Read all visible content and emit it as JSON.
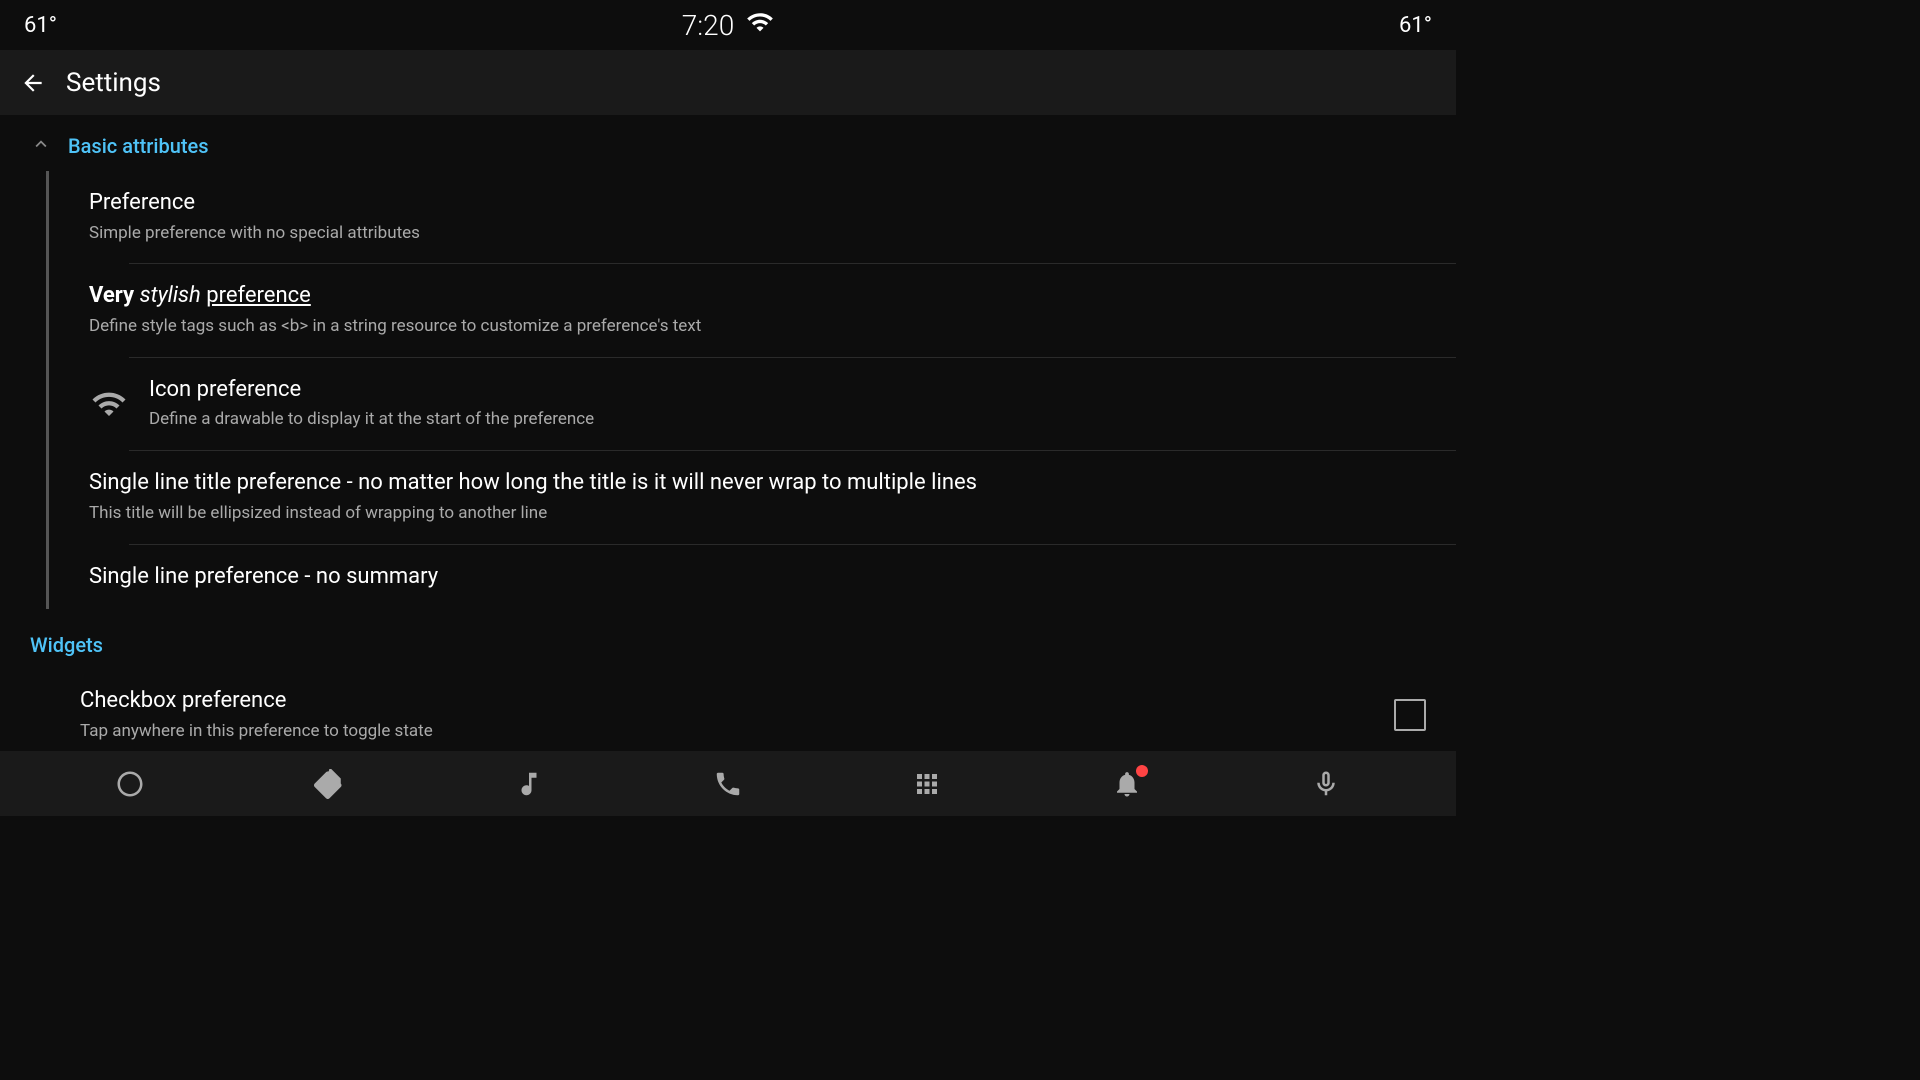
{
  "status_bar": {
    "temp_left": "61°",
    "time": "7:20",
    "temp_right": "61°"
  },
  "header": {
    "back_label": "back",
    "title": "Settings"
  },
  "sections": [
    {
      "id": "basic-attributes",
      "title": "Basic attributes",
      "collapsed": false,
      "preferences": [
        {
          "id": "preference",
          "title_parts": [
            {
              "text": "Preference",
              "style": "normal"
            }
          ],
          "summary": "Simple preference with no special attributes",
          "has_icon": false
        },
        {
          "id": "stylish-preference",
          "title_parts": [
            {
              "text": "Very ",
              "style": "bold"
            },
            {
              "text": "stylish ",
              "style": "italic"
            },
            {
              "text": "preference",
              "style": "underline"
            }
          ],
          "summary": "Define style tags such as <b> in a string resource to customize a preference's text",
          "has_icon": false
        },
        {
          "id": "icon-preference",
          "title_parts": [
            {
              "text": "Icon preference",
              "style": "normal"
            }
          ],
          "summary": "Define a drawable to display it at the start of the preference",
          "has_icon": true,
          "icon_name": "wifi-icon"
        },
        {
          "id": "single-line-title",
          "title_parts": [
            {
              "text": "Single line title preference - no matter how long the title is it will never wrap to multiple lines",
              "style": "normal"
            }
          ],
          "summary": "This title will be ellipsized instead of wrapping to another line",
          "has_icon": false
        },
        {
          "id": "single-line-no-summary",
          "title_parts": [
            {
              "text": "Single line preference - no summary",
              "style": "normal"
            }
          ],
          "summary": "",
          "has_icon": false
        }
      ]
    },
    {
      "id": "widgets",
      "title": "Widgets",
      "collapsed": false,
      "preferences": [
        {
          "id": "checkbox-preference",
          "title_parts": [
            {
              "text": "Checkbox preference",
              "style": "normal"
            }
          ],
          "summary": "Tap anywhere in this preference to toggle state",
          "has_widget": "checkbox"
        }
      ]
    }
  ],
  "bottom_nav": {
    "items": [
      {
        "id": "home",
        "icon": "home-icon"
      },
      {
        "id": "navigation",
        "icon": "navigation-icon"
      },
      {
        "id": "music",
        "icon": "music-icon"
      },
      {
        "id": "phone",
        "icon": "phone-icon"
      },
      {
        "id": "grid",
        "icon": "grid-icon"
      },
      {
        "id": "notifications",
        "icon": "notifications-icon",
        "has_badge": true
      },
      {
        "id": "microphone",
        "icon": "microphone-icon"
      }
    ]
  },
  "colors": {
    "accent": "#4fc3f7",
    "background": "#0d0d0d",
    "surface": "#1a1a1a",
    "text_primary": "#ffffff",
    "text_secondary": "#aaaaaa",
    "divider": "#2a2a2a"
  }
}
